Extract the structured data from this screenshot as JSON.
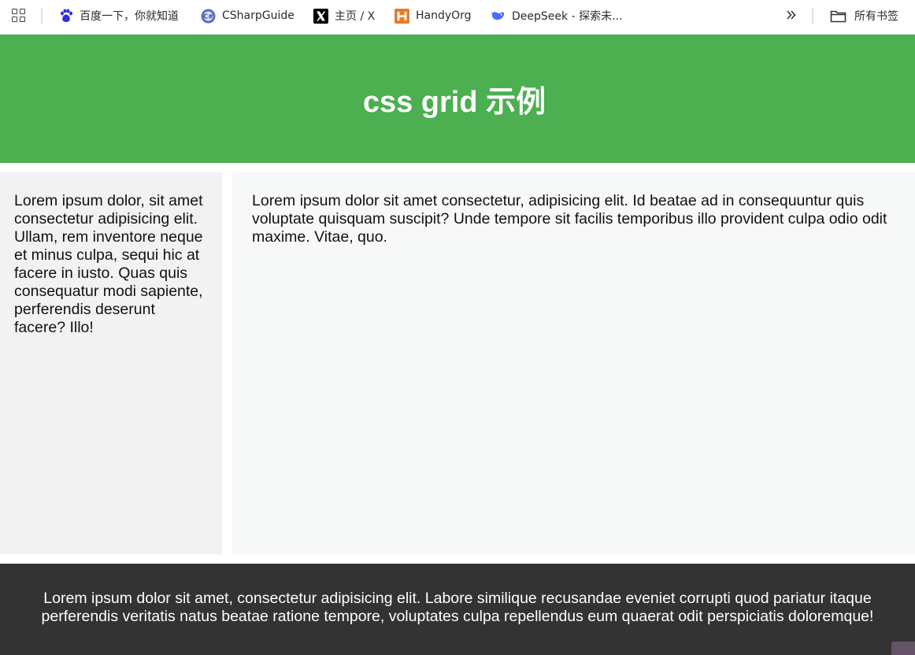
{
  "bookmarks_bar": {
    "items": [
      {
        "label": "百度一下，你就知道",
        "icon": "paw-icon"
      },
      {
        "label": "CSharpGuide",
        "icon": "csharp-icon"
      },
      {
        "label": "主页 / X",
        "icon": "x-logo-icon"
      },
      {
        "label": "HandyOrg",
        "icon": "handyorg-icon"
      },
      {
        "label": "DeepSeek - 探索未...",
        "icon": "whale-icon"
      }
    ],
    "more_icon": "chevron-double-right-icon",
    "all_bookmarks_label": "所有书签",
    "all_bookmarks_icon": "folder-icon"
  },
  "page": {
    "header_title": "css grid 示例",
    "sidebar_text": "Lorem ipsum dolor, sit amet consectetur adipisicing elit. Ullam, rem inventore neque et minus culpa, sequi hic at facere in iusto. Quas quis consequatur modi sapiente, perferendis deserunt facere? Illo!",
    "main_text": "Lorem ipsum dolor sit amet consectetur, adipisicing elit. Id beatae ad in consequuntur quis voluptate quisquam suscipit? Unde tempore sit facilis temporibus illo provident culpa odio odit maxime. Vitae, quo.",
    "footer_text": "Lorem ipsum dolor sit amet, consectetur adipisicing elit. Labore similique recusandae eveniet corrupti quod pariatur itaque perferendis veritatis natus beatae ratione tempore, voluptates culpa repellendus eum quaerat odit perspiciatis doloremque!"
  },
  "colors": {
    "header_bg": "#4caf50",
    "sidebar_bg": "#f2f2f2",
    "main_bg": "#f7f9f8",
    "footer_bg": "#333333"
  }
}
